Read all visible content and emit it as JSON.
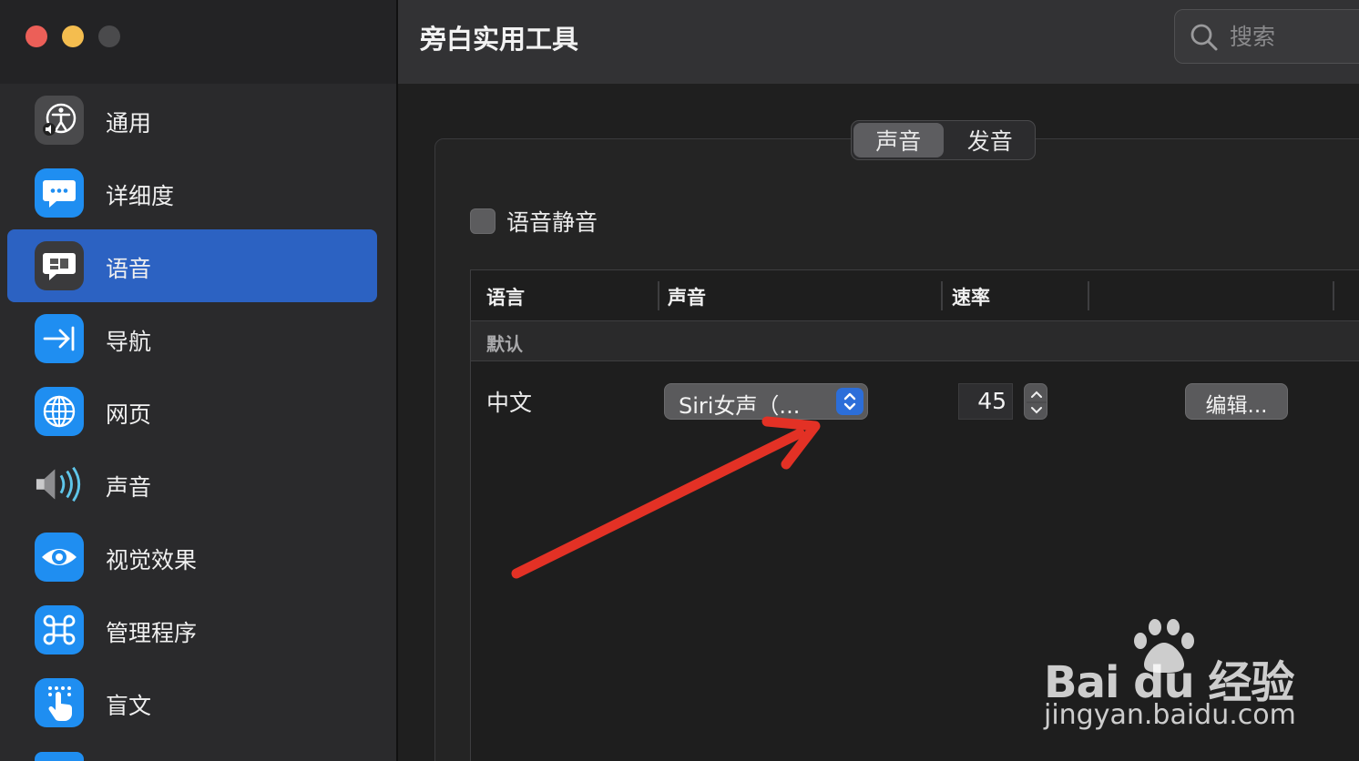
{
  "window": {
    "title": "旁白实用工具"
  },
  "search": {
    "placeholder": "搜索"
  },
  "sidebar": {
    "items": [
      {
        "label": "通用",
        "icon": "accessibility-icon"
      },
      {
        "label": "详细度",
        "icon": "speech-bubble-icon"
      },
      {
        "label": "语音",
        "icon": "voice-bubble-icon",
        "selected": true
      },
      {
        "label": "导航",
        "icon": "arrow-to-bar-icon"
      },
      {
        "label": "网页",
        "icon": "globe-icon"
      },
      {
        "label": "声音",
        "icon": "speaker-icon"
      },
      {
        "label": "视觉效果",
        "icon": "eye-icon"
      },
      {
        "label": "管理程序",
        "icon": "command-icon"
      },
      {
        "label": "盲文",
        "icon": "braille-hand-icon"
      }
    ]
  },
  "tabs": [
    {
      "label": "声音",
      "selected": true
    },
    {
      "label": "发音",
      "selected": false
    }
  ],
  "mute": {
    "label": "语音静音",
    "checked": false
  },
  "table": {
    "headers": {
      "language": "语言",
      "voice": "声音",
      "rate": "速率"
    },
    "group": "默认",
    "row": {
      "language": "中文",
      "voice": "Siri女声（...",
      "rate": "45",
      "edit": "编辑..."
    }
  },
  "watermark": {
    "brand": "Bai du 经验",
    "url": "jingyan.baidu.com"
  },
  "colors": {
    "accent": "#2c62c2",
    "annotation_arrow": "#e33125"
  }
}
